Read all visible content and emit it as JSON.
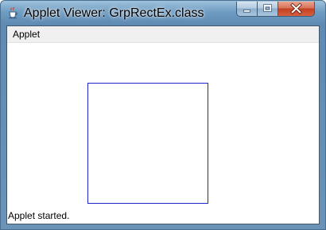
{
  "window": {
    "title": "Applet Viewer: GrpRectEx.class",
    "app_icon": "java-cup-icon",
    "controls": {
      "minimize_icon": "minimize-icon",
      "maximize_icon": "maximize-icon",
      "close_icon": "close-icon"
    }
  },
  "menu": {
    "items": [
      {
        "label": "Applet"
      }
    ]
  },
  "canvas": {
    "shape": "rectangle",
    "stroke_color": "#2222cc"
  },
  "status": {
    "text": "Applet started."
  },
  "colors": {
    "close_button": "#c23f22",
    "frame": "#6f9cc2"
  }
}
